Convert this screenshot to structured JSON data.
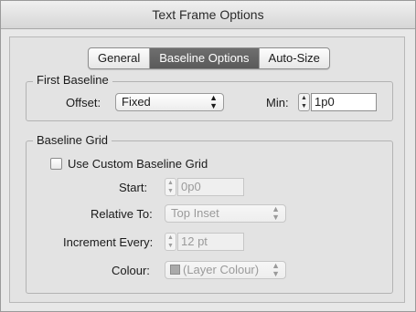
{
  "window": {
    "title": "Text Frame Options"
  },
  "tabs": [
    {
      "label": "General",
      "active": false
    },
    {
      "label": "Baseline Options",
      "active": true
    },
    {
      "label": "Auto-Size",
      "active": false
    }
  ],
  "first_baseline": {
    "title": "First Baseline",
    "offset_label": "Offset:",
    "offset_value": "Fixed",
    "min_label": "Min:",
    "min_value": "1p0"
  },
  "baseline_grid": {
    "title": "Baseline Grid",
    "use_custom_label": "Use Custom Baseline Grid",
    "use_custom_checked": false,
    "start_label": "Start:",
    "start_value": "0p0",
    "relative_to_label": "Relative To:",
    "relative_to_value": "Top Inset",
    "increment_label": "Increment Every:",
    "increment_value": "12 pt",
    "colour_label": "Colour:",
    "colour_value": "(Layer Colour)"
  },
  "colors": {
    "active_tab": "#5f5f5f",
    "swatch": "#aaaaaa"
  }
}
